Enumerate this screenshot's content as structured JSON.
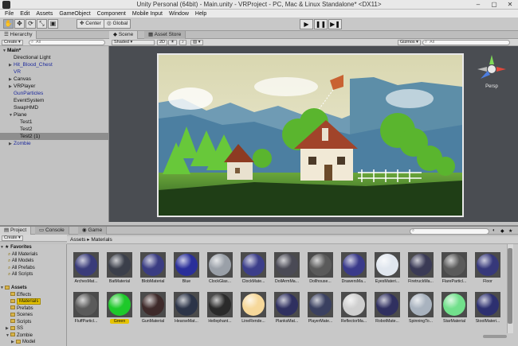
{
  "window": {
    "title": "Unity Personal (64bit) - Main.unity - VRProject - PC, Mac & Linux Standalone* <DX11>"
  },
  "menu": [
    "File",
    "Edit",
    "Assets",
    "GameObject",
    "Component",
    "Mobile Input",
    "Window",
    "Help"
  ],
  "toolbar": {
    "center_label": "Center",
    "global_label": "Global"
  },
  "hierarchy": {
    "tab": "Hierarchy",
    "create_label": "Create",
    "search_placeholder": "All",
    "rows": [
      {
        "label": "Main*",
        "indent": 0,
        "arrow": "▼",
        "color": "#000000"
      },
      {
        "label": "Directional Light",
        "indent": 1,
        "arrow": "",
        "color": "#111111"
      },
      {
        "label": "Hit_Blood_Chest",
        "indent": 1,
        "arrow": "▶",
        "color": "#1d2a9c"
      },
      {
        "label": "VR",
        "indent": 1,
        "arrow": "",
        "color": "#1d2a9c"
      },
      {
        "label": "Canvas",
        "indent": 1,
        "arrow": "▶",
        "color": "#111111"
      },
      {
        "label": "VRPlayer",
        "indent": 1,
        "arrow": "▶",
        "color": "#111111"
      },
      {
        "label": "GunParticles",
        "indent": 1,
        "arrow": "",
        "color": "#1d2a9c"
      },
      {
        "label": "EventSystem",
        "indent": 1,
        "arrow": "",
        "color": "#111111"
      },
      {
        "label": "SwapHMD",
        "indent": 1,
        "arrow": "",
        "color": "#111111"
      },
      {
        "label": "Plane",
        "indent": 1,
        "arrow": "▼",
        "color": "#111111"
      },
      {
        "label": "Test1",
        "indent": 2,
        "arrow": "",
        "color": "#111111"
      },
      {
        "label": "Test2",
        "indent": 2,
        "arrow": "",
        "color": "#111111"
      },
      {
        "label": "Test2 (1)",
        "indent": 2,
        "arrow": "",
        "color": "#111111",
        "selected": true
      },
      {
        "label": "Zombie",
        "indent": 1,
        "arrow": "▶",
        "color": "#1d2a9c"
      }
    ]
  },
  "scene": {
    "tab_scene": "Scene",
    "tab_asset_store": "Asset Store",
    "shaded_label": "Shaded",
    "mode_2d": "2D",
    "gizmos_label": "Gizmos",
    "search_placeholder": "All",
    "persp_label": "Persp"
  },
  "project": {
    "tab_project": "Project",
    "tab_console": "Console",
    "tab_game": "Game",
    "create_label": "Create",
    "breadcrumb": "Assets ▸ Materials",
    "favorites_label": "Favorites",
    "favorites": [
      "All Materials",
      "All Models",
      "All Prefabs",
      "All Scripts"
    ],
    "assets_label": "Assets",
    "folders": [
      {
        "label": "Effects",
        "indent": 1,
        "arrow": ""
      },
      {
        "label": "Materials",
        "indent": 1,
        "arrow": "",
        "selected": true
      },
      {
        "label": "Prefabs",
        "indent": 1,
        "arrow": ""
      },
      {
        "label": "Scenes",
        "indent": 1,
        "arrow": ""
      },
      {
        "label": "Scripts",
        "indent": 1,
        "arrow": ""
      },
      {
        "label": "SS",
        "indent": 1,
        "arrow": "▶"
      },
      {
        "label": "Zombie",
        "indent": 1,
        "arrow": "▼"
      },
      {
        "label": "Model",
        "indent": 2,
        "arrow": "▶"
      }
    ],
    "materials_row1": [
      {
        "label": "ArchesMat...",
        "color": "#3a3c7a"
      },
      {
        "label": "BatMaterial",
        "color": "#3b3f4a"
      },
      {
        "label": "BlobMaterial",
        "color": "#3a3c82"
      },
      {
        "label": "Blue",
        "color": "#2a2f9a"
      },
      {
        "label": "ClockGlas...",
        "color": "#9aa0a8"
      },
      {
        "label": "ClockMate...",
        "color": "#3c3e8a"
      },
      {
        "label": "DollArmMa...",
        "color": "#4a4a55"
      },
      {
        "label": "Dollhouse...",
        "color": "#5a5a5a"
      },
      {
        "label": "DrawersMa...",
        "color": "#3a3a8a"
      },
      {
        "label": "EyesMateri...",
        "color": "#e0e6ee"
      },
      {
        "label": "FiretruckMa...",
        "color": "#3a3a55"
      },
      {
        "label": "FlareParticl...",
        "color": "#5a5a5a"
      },
      {
        "label": "Floor",
        "color": "#36387a"
      }
    ],
    "materials_row2": [
      {
        "label": "FluffParticl...",
        "color": "#5a5a5a"
      },
      {
        "label": "Green",
        "color": "#1ec92a"
      },
      {
        "label": "GunMaterial",
        "color": "#3e2a2a"
      },
      {
        "label": "HearseMat...",
        "color": "#2c3448"
      },
      {
        "label": "Hellephant...",
        "color": "#2a2a2a"
      },
      {
        "label": "LineRende...",
        "color": "#f6d89a"
      },
      {
        "label": "PlanksMat...",
        "color": "#2f3060"
      },
      {
        "label": "PlayerMate...",
        "color": "#3a4060"
      },
      {
        "label": "ReflectorMa...",
        "color": "#cfcfcf"
      },
      {
        "label": "RobotMate...",
        "color": "#303060"
      },
      {
        "label": "SpinningTo...",
        "color": "#a9b3bf"
      },
      {
        "label": "StarMaterial",
        "color": "#72e08c"
      },
      {
        "label": "StoolMateri...",
        "color": "#2d3070"
      }
    ]
  }
}
